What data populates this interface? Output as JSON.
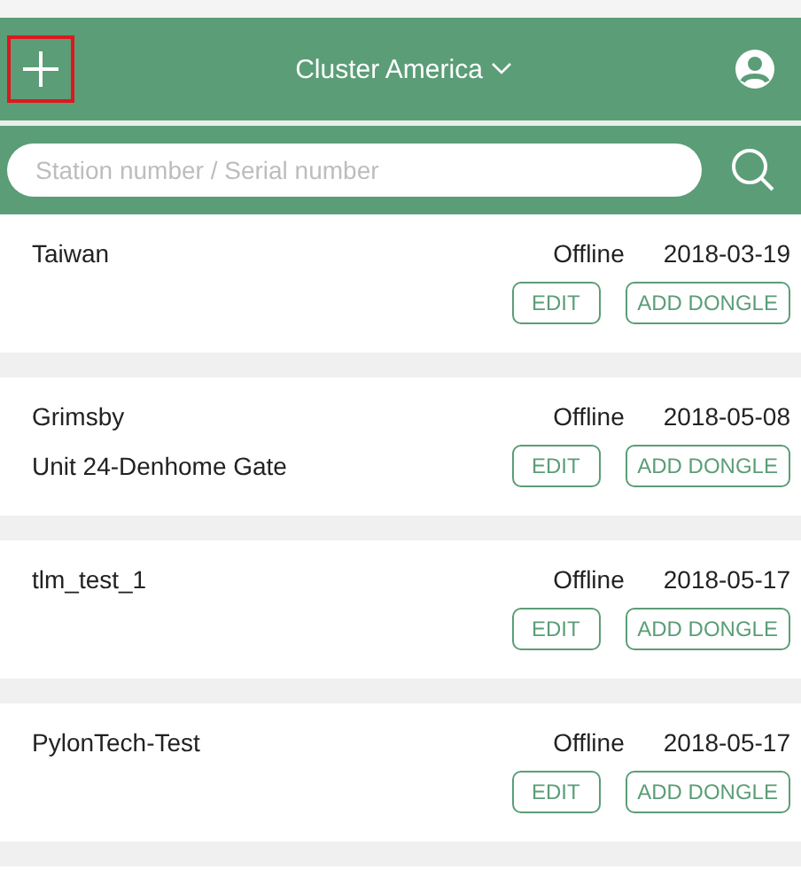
{
  "header": {
    "add_button": {
      "highlighted": true
    },
    "title": "Cluster America"
  },
  "search": {
    "placeholder": "Station number / Serial number"
  },
  "stations": [
    {
      "name": "Taiwan",
      "status": "Offline",
      "date": "2018-03-19",
      "buttons": [
        "EDIT",
        "ADD DONGLE"
      ]
    },
    {
      "name": "Grimsby",
      "address": "Unit 24-Denhome Gate",
      "status": "Offline",
      "date": "2018-05-08",
      "buttons": [
        "EDIT",
        "ADD DONGLE"
      ]
    },
    {
      "name": "tlm_test_1",
      "status": "Offline",
      "date": "2018-05-17",
      "buttons": [
        "EDIT",
        "ADD DONGLE"
      ]
    },
    {
      "name": "PylonTech-Test",
      "status": "Offline",
      "date": "2018-05-17",
      "buttons": [
        "EDIT",
        "ADD DONGLE"
      ]
    }
  ]
}
